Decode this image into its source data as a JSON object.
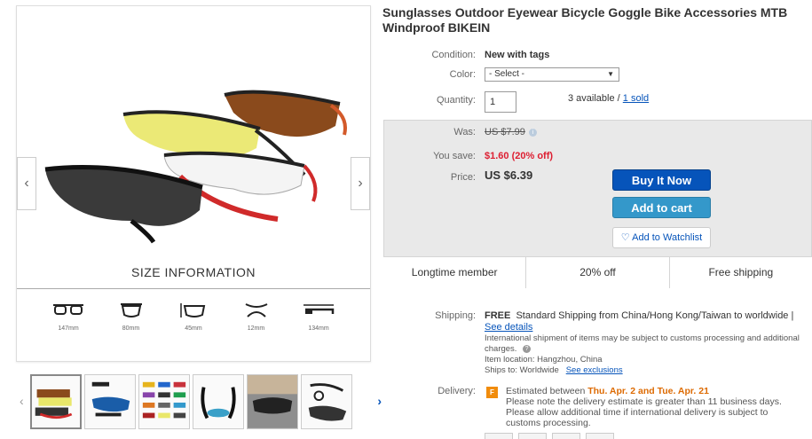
{
  "product": {
    "title": "Sunglasses Outdoor Eyewear Bicycle Goggle Bike Accessories MTB Windproof BIKEIN"
  },
  "gallery": {
    "size_title": "SIZE INFORMATION",
    "sizes": [
      "147mm",
      "80mm",
      "45mm",
      "12mm",
      "134mm"
    ],
    "prev_icon": "chevron-left-icon",
    "next_icon": "chevron-right-icon"
  },
  "details": {
    "condition_label": "Condition:",
    "condition_value": "New with tags",
    "color_label": "Color:",
    "color_select": "- Select -",
    "quantity_label": "Quantity:",
    "quantity_value": "1",
    "available_text": "3 available /",
    "sold_link": "1 sold"
  },
  "pricing": {
    "was_label": "Was:",
    "was_value": "US $7.99",
    "save_label": "You save:",
    "save_value": "$1.60 (20% off)",
    "price_label": "Price:",
    "price_value": "US $6.39",
    "buy_now": "Buy It Now",
    "add_to_cart": "Add to cart",
    "watchlist": "Add to Watchlist"
  },
  "badges": [
    "Longtime member",
    "20% off",
    "Free shipping"
  ],
  "shipping": {
    "label": "Shipping:",
    "free": "FREE",
    "desc": "Standard Shipping from China/Hong Kong/Taiwan to worldwide |",
    "see_details": "See details",
    "intl_note": "International shipment of items may be subject to customs processing and additional charges.",
    "location": "Item location:  Hangzhou, China",
    "ships_to_label": "Ships to:  Worldwide",
    "exclusions": "See exclusions"
  },
  "delivery": {
    "label": "Delivery:",
    "estimated_prefix": "Estimated between",
    "estimated_dates": "Thu. Apr. 2 and Tue. Apr. 21",
    "note1": "Please note the delivery estimate is greater than 11 business days.",
    "note2": "Please allow additional time if international delivery is subject to customs processing."
  },
  "colors": {
    "accent": "#0654ba",
    "cart": "#3498ca",
    "save_red": "#dd1e31",
    "flag_orange": "#f18c0c"
  }
}
